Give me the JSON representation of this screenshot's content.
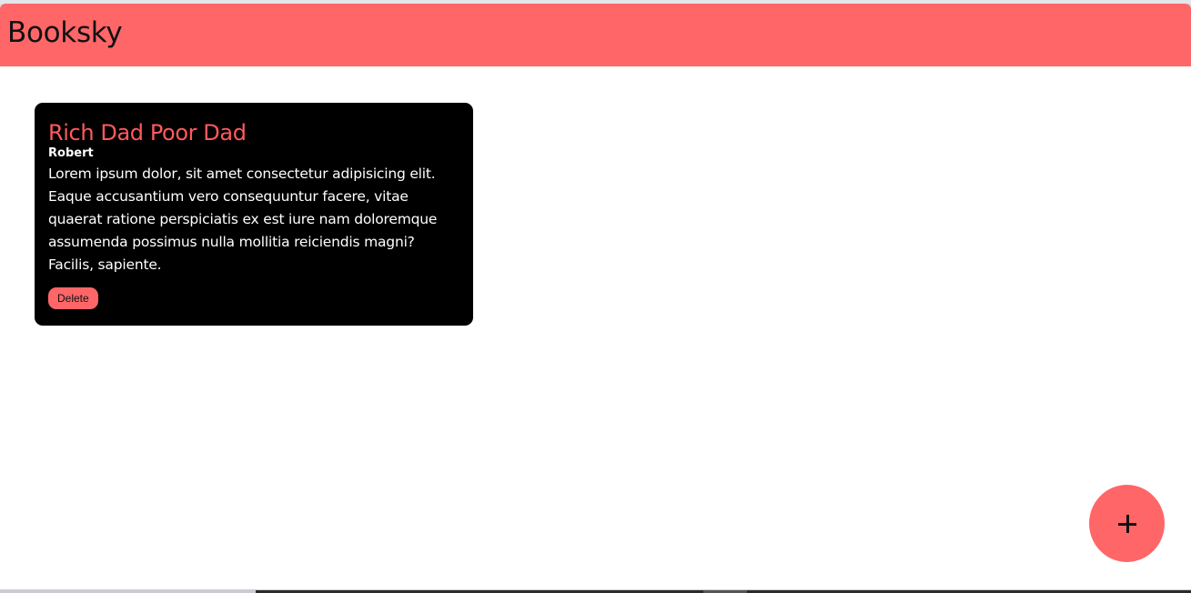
{
  "header": {
    "brand": "Booksky",
    "accent": "#ff6668"
  },
  "books": [
    {
      "title": "Rich Dad Poor Dad",
      "author": "Robert",
      "description": "Lorem ipsum dolor, sit amet consectetur adipisicing elit. Eaque accusantium vero consequuntur facere, vitae quaerat ratione perspiciatis ex est iure nam doloremque assumenda possimus nulla mollitia reiciendis magni? Facilis, sapiente.",
      "delete_label": "Delete"
    }
  ],
  "fab": {
    "icon": "plus-icon"
  }
}
